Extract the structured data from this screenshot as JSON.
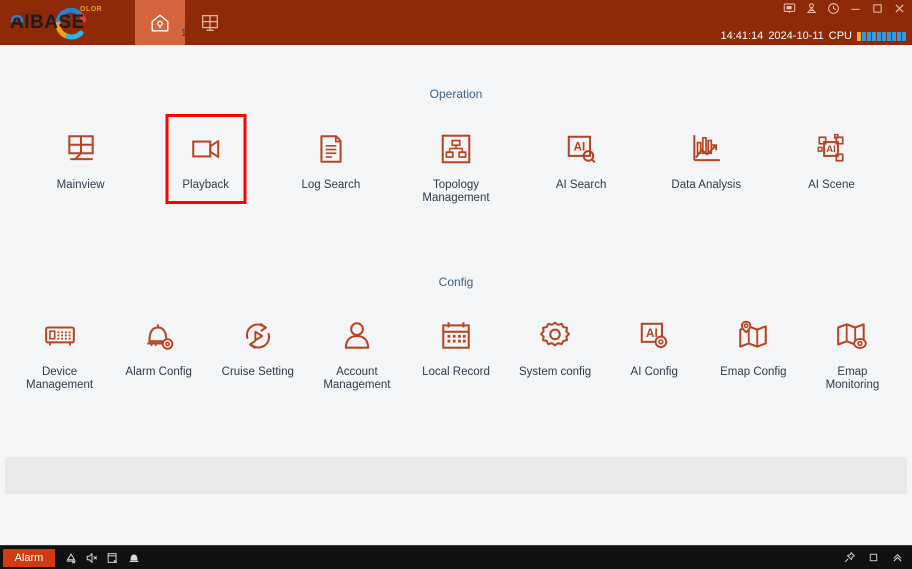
{
  "app": {
    "brand_name": "AIBASE",
    "brand_suffix": "OLOR",
    "accent_color": "#8e2a08",
    "icon_color": "#b54422",
    "highlight_color": "#ff0000",
    "section_title_color": "#3f6186"
  },
  "topbar": {
    "tabs": [
      {
        "name": "home-tab",
        "icon": "home-icon",
        "badge": "",
        "active": true
      },
      {
        "name": "layout-tab",
        "icon": "grid-layout-icon",
        "badge": "1",
        "active": false
      }
    ],
    "window_controls": [
      {
        "name": "screen-icon",
        "label": "screen"
      },
      {
        "name": "user-lock-icon",
        "label": "user"
      },
      {
        "name": "power-icon",
        "label": "power"
      },
      {
        "name": "minimize-button",
        "label": "minimize"
      },
      {
        "name": "maximize-button",
        "label": "maximize"
      },
      {
        "name": "close-button",
        "label": "close"
      }
    ],
    "status": {
      "time": "14:41:14",
      "date": "2024-10-11",
      "cpu_label": "CPU",
      "cpu_segments": 10,
      "cpu_first_color": "#f5b323",
      "cpu_color": "#2f9be0"
    }
  },
  "main": {
    "sections": [
      {
        "title": "Operation",
        "items": [
          {
            "label": "Mainview",
            "icon": "mainview-icon",
            "highlight": false
          },
          {
            "label": "Playback",
            "icon": "playback-camera-icon",
            "highlight": true
          },
          {
            "label": "Log Search",
            "icon": "log-search-icon",
            "highlight": false
          },
          {
            "label": "Topology\nManagement",
            "icon": "topology-icon",
            "highlight": false
          },
          {
            "label": "AI Search",
            "icon": "ai-search-icon",
            "highlight": false
          },
          {
            "label": "Data Analysis",
            "icon": "data-analysis-icon",
            "highlight": false
          },
          {
            "label": "AI Scene",
            "icon": "ai-scene-icon",
            "highlight": false
          }
        ]
      },
      {
        "title": "Config",
        "items": [
          {
            "label": "Device\nManagement",
            "icon": "device-management-icon",
            "highlight": false
          },
          {
            "label": "Alarm Config",
            "icon": "alarm-config-icon",
            "highlight": false
          },
          {
            "label": "Cruise Setting",
            "icon": "cruise-setting-icon",
            "highlight": false
          },
          {
            "label": "Account\nManagement",
            "icon": "account-management-icon",
            "highlight": false
          },
          {
            "label": "Local Record",
            "icon": "local-record-icon",
            "highlight": false
          },
          {
            "label": "System config",
            "icon": "system-config-icon",
            "highlight": false
          },
          {
            "label": "AI Config",
            "icon": "ai-config-icon",
            "highlight": false
          },
          {
            "label": "Emap Config",
            "icon": "emap-config-icon",
            "highlight": false
          },
          {
            "label": "Emap\nMonitoring",
            "icon": "emap-monitoring-icon",
            "highlight": false
          }
        ]
      }
    ]
  },
  "statusbar": {
    "alarm_label": "Alarm",
    "left_icons": [
      {
        "name": "alarm-muted-icon"
      },
      {
        "name": "speaker-muted-icon"
      },
      {
        "name": "record-off-icon"
      },
      {
        "name": "bell-icon"
      }
    ],
    "right_icons": [
      {
        "name": "pin-icon"
      },
      {
        "name": "restore-icon"
      },
      {
        "name": "chevron-up-icon"
      }
    ]
  }
}
